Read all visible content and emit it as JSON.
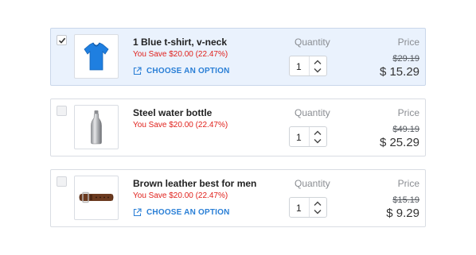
{
  "labels": {
    "quantity": "Quantity",
    "price": "Price",
    "choose_option": "CHOOSE AN OPTION"
  },
  "colors": {
    "accent": "#2a7fd6",
    "savings": "#e0201b",
    "selected_bg": "#eaf2fd"
  },
  "items": [
    {
      "name": "1 Blue t-shirt, v-neck",
      "savings": "You Save $20.00 (22.47%)",
      "quantity": "1",
      "old_price": "$29.19",
      "new_price": "$ 15.29",
      "checked": true,
      "has_option": true,
      "image": "blue-tshirt-image"
    },
    {
      "name": "Steel water bottle",
      "savings": "You Save $20.00 (22.47%)",
      "quantity": "1",
      "old_price": "$49.19",
      "new_price": "$ 25.29",
      "checked": false,
      "has_option": false,
      "image": "water-bottle-image"
    },
    {
      "name": "Brown leather best for men",
      "savings": "You Save $20.00 (22.47%)",
      "quantity": "1",
      "old_price": "$15.19",
      "new_price": "$ 9.29",
      "checked": false,
      "has_option": true,
      "image": "leather-belt-image"
    }
  ]
}
